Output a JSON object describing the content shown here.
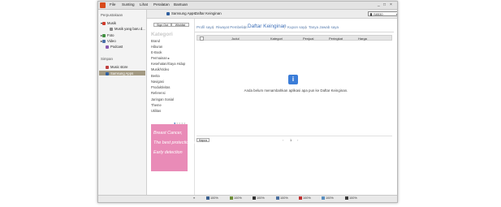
{
  "menubar": {
    "items": [
      "File",
      "Sunting",
      "Lihat",
      "Peralatan",
      "Bantuan"
    ],
    "controls": [
      "_",
      "□",
      "×"
    ]
  },
  "sidebar": {
    "library_heading": "Perpustakaan",
    "library_items": [
      {
        "label": "Musik",
        "icon": "music-icon"
      },
      {
        "label": "Musik yang baru d...",
        "icon": "music-file-icon"
      },
      {
        "label": "Foto",
        "icon": "photo-icon"
      },
      {
        "label": "Video",
        "icon": "video-icon"
      },
      {
        "label": "Podcast",
        "icon": "podcast-icon"
      }
    ],
    "store_heading": "Simpan",
    "store_items": [
      {
        "label": "Music store",
        "icon": "music-store-icon"
      },
      {
        "label": "Samsung Apps",
        "icon": "samsung-apps-icon"
      }
    ]
  },
  "topbar": {
    "crumb_root": "Samsung Apps",
    "crumb_sep": "›",
    "crumb_current": "Daftar Keinginan",
    "device": "S8530"
  },
  "category_panel": {
    "sign_out": "Sign Out",
    "wishlist_btn": "Wishlist",
    "heading": "Kategori",
    "items": [
      "Brand",
      "Hiburan",
      "E-Book",
      "Permainan ▸",
      "Kesehatan/Gaya Hidup",
      "Musik/Video",
      "Berita",
      "Navigasi",
      "Produktivitas",
      "Referensi",
      "Jaringan Sosial",
      "Theme",
      "Utilitas"
    ],
    "ad_lines": [
      "Breast Cancer,",
      "The best protection is",
      "Early detection"
    ]
  },
  "main": {
    "tabs": [
      {
        "label": "Profil saya",
        "active": false
      },
      {
        "label": "Riwayat Pembelian",
        "active": false
      },
      {
        "label": "Daftar Keinginan",
        "active": true
      },
      {
        "label": "Kupon saya",
        "active": false
      },
      {
        "label": "Tanya Jawab saya",
        "active": false
      }
    ],
    "columns": [
      "Judul",
      "Kategori",
      "Penjual",
      "Peringkat",
      "Harga"
    ],
    "empty_icon": "i",
    "empty_message": "Anda belum menambahkan aplikasi apa pun ke Daftar Keinginan.",
    "delete_button": "Hapus",
    "page_prev": "‹",
    "page_number": "1",
    "page_next": "›"
  },
  "statusbar": {
    "items": [
      {
        "label": "100%",
        "color": "#3a5f8f"
      },
      {
        "label": "100%",
        "color": "#6f8f3a"
      },
      {
        "label": "100%",
        "color": "#333333"
      },
      {
        "label": "100%",
        "color": "#4a6f9f"
      },
      {
        "label": "100%",
        "color": "#c03030"
      },
      {
        "label": "100%",
        "color": "#5a8fbf"
      },
      {
        "label": "100%",
        "color": "#3a3a3a"
      }
    ]
  },
  "colors": {
    "accent": "#3d6fb8",
    "selected": "#a39a82",
    "ad": "#e98bb7"
  }
}
